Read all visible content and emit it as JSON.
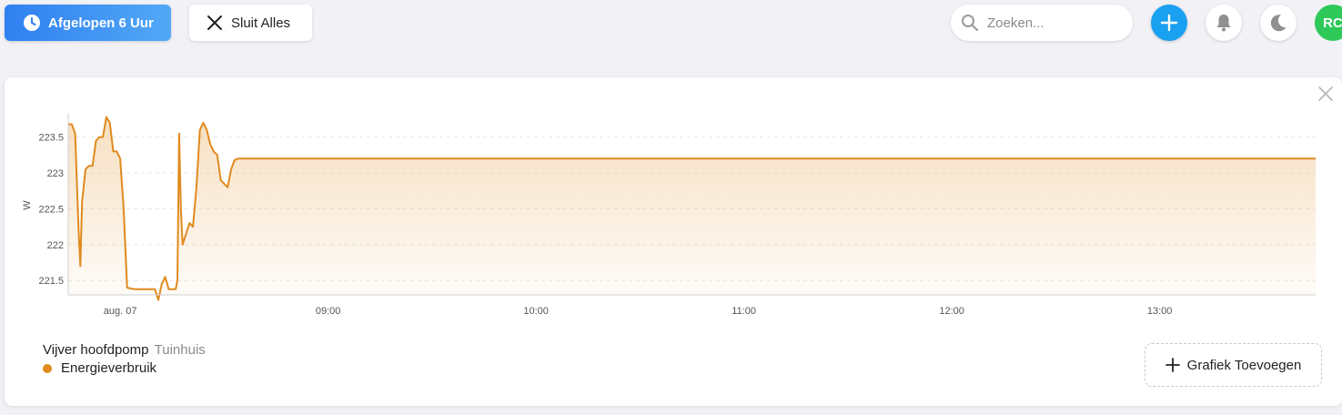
{
  "toolbar": {
    "range_label": "Afgelopen 6 Uur",
    "close_all_label": "Sluit Alles",
    "search_placeholder": "Zoeken...",
    "avatar_initials": "RC"
  },
  "colors": {
    "accent": "#2f80f0",
    "add_button": "#1aa0f0",
    "avatar": "#2fc95a",
    "series": "#e08a1e"
  },
  "card": {
    "legend": {
      "device": "Vijver hoofdpomp",
      "location": "Tuinhuis",
      "series_label": "Energieverbruik"
    },
    "add_chart_label": "Grafiek Toevoegen"
  },
  "chart_data": {
    "type": "area",
    "ylabel": "W",
    "ylim": [
      221.3,
      223.8
    ],
    "yticks": [
      221.5,
      222,
      222.5,
      223,
      223.5
    ],
    "ytick_labels": [
      "221.5",
      "222",
      "222.5",
      "223",
      "223.5"
    ],
    "xticks": [
      "aug. 07",
      "09:00",
      "10:00",
      "11:00",
      "12:00",
      "13:00"
    ],
    "xlim": [
      "07:45",
      "13:45"
    ],
    "grid": true,
    "series": [
      {
        "name": "Energieverbruik",
        "points": [
          [
            "07:45",
            223.68
          ],
          [
            "07:46",
            223.68
          ],
          [
            "07:47",
            223.55
          ],
          [
            "07:48",
            222.2
          ],
          [
            "07:48:30",
            221.7
          ],
          [
            "07:49",
            222.6
          ],
          [
            "07:50",
            223.05
          ],
          [
            "07:51",
            223.1
          ],
          [
            "07:52",
            223.1
          ],
          [
            "07:53",
            223.45
          ],
          [
            "07:54",
            223.5
          ],
          [
            "07:55",
            223.5
          ],
          [
            "07:56",
            223.78
          ],
          [
            "07:57",
            223.7
          ],
          [
            "07:58",
            223.3
          ],
          [
            "07:59",
            223.3
          ],
          [
            "08:00",
            223.2
          ],
          [
            "08:01",
            222.5
          ],
          [
            "08:02",
            221.4
          ],
          [
            "08:04",
            221.38
          ],
          [
            "08:06",
            221.38
          ],
          [
            "08:08",
            221.38
          ],
          [
            "08:10",
            221.38
          ],
          [
            "08:11",
            221.23
          ],
          [
            "08:12",
            221.45
          ],
          [
            "08:13",
            221.55
          ],
          [
            "08:14",
            221.38
          ],
          [
            "08:16",
            221.38
          ],
          [
            "08:16:30",
            221.5
          ],
          [
            "08:17",
            223.55
          ],
          [
            "08:17:30",
            222.5
          ],
          [
            "08:18",
            222.0
          ],
          [
            "08:19",
            222.15
          ],
          [
            "08:20",
            222.3
          ],
          [
            "08:21",
            222.25
          ],
          [
            "08:22",
            222.8
          ],
          [
            "08:23",
            223.6
          ],
          [
            "08:24",
            223.7
          ],
          [
            "08:25",
            223.6
          ],
          [
            "08:26",
            223.4
          ],
          [
            "08:27",
            223.3
          ],
          [
            "08:28",
            223.25
          ],
          [
            "08:29",
            222.9
          ],
          [
            "08:30",
            222.85
          ],
          [
            "08:31",
            222.8
          ],
          [
            "08:32",
            223.05
          ],
          [
            "08:33",
            223.18
          ],
          [
            "08:34",
            223.2
          ],
          [
            "08:40",
            223.2
          ],
          [
            "09:00",
            223.2
          ],
          [
            "10:00",
            223.2
          ],
          [
            "11:00",
            223.2
          ],
          [
            "12:00",
            223.2
          ],
          [
            "13:00",
            223.2
          ],
          [
            "13:45",
            223.2
          ]
        ]
      }
    ]
  }
}
